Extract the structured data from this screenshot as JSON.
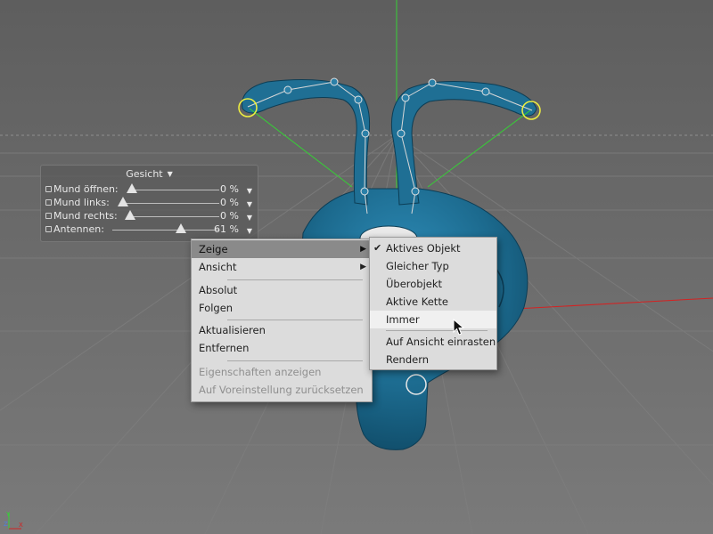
{
  "hud": {
    "title": "Gesicht",
    "rows": [
      {
        "label": "Mund öffnen:",
        "value": "0 %",
        "level": 0.0
      },
      {
        "label": "Mund links:",
        "value": "0 %",
        "level": 0.0
      },
      {
        "label": "Mund rechts:",
        "value": "0 %",
        "level": 0.0
      },
      {
        "label": "Antennen:",
        "value": "61 %",
        "level": 0.61
      }
    ]
  },
  "menu": {
    "items": [
      {
        "label": "Zeige",
        "submenu": true,
        "state": "selected"
      },
      {
        "label": "Ansicht",
        "submenu": true
      },
      {
        "label": "Absolut"
      },
      {
        "label": "Folgen"
      },
      {
        "label": "Aktualisieren"
      },
      {
        "label": "Entfernen"
      },
      {
        "label": "Eigenschaften anzeigen",
        "disabled": true
      },
      {
        "label": "Auf Voreinstellung zurücksetzen",
        "disabled": true
      }
    ]
  },
  "submenu": {
    "items": [
      {
        "label": "Aktives Objekt",
        "checked": true
      },
      {
        "label": "Gleicher Typ"
      },
      {
        "label": "Überobjekt"
      },
      {
        "label": "Aktive Kette"
      },
      {
        "label": "Immer",
        "hovered": true
      },
      {
        "label": "Auf Ansicht einrasten"
      },
      {
        "label": "Rendern"
      }
    ]
  },
  "axes": {
    "x": "X",
    "y": "Y",
    "z": "Z"
  },
  "colors": {
    "model": "#1f6f94",
    "viewport_bg": "#6f6f6f",
    "ik_line": "#36d036",
    "x_axis": "#d42222",
    "selection": "#f0f040"
  }
}
